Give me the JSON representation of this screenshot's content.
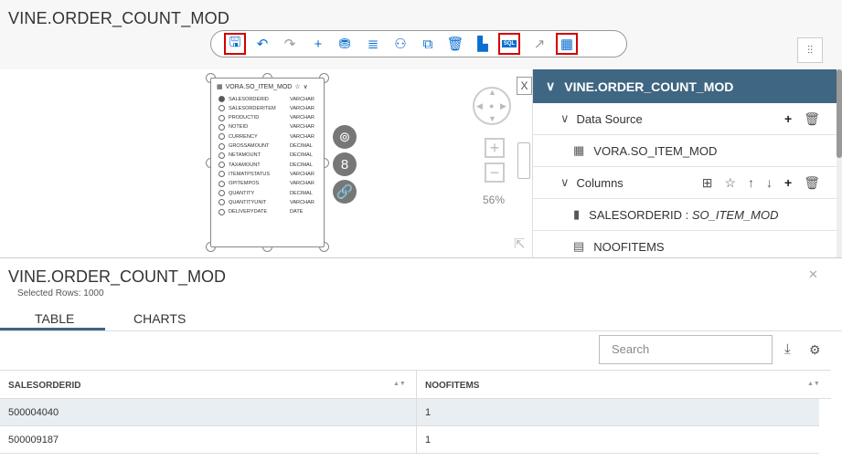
{
  "app": {
    "title": "VINE.ORDER_COUNT_MOD"
  },
  "toolbar": {
    "buttons": [
      {
        "icon": "save-icon",
        "glyph": "🖫",
        "highlighted": true
      },
      {
        "icon": "undo-icon",
        "glyph": "↶"
      },
      {
        "icon": "redo-icon",
        "glyph": "↷",
        "disabled": true
      },
      {
        "icon": "add-icon",
        "glyph": "+"
      },
      {
        "icon": "datasource-icon",
        "glyph": "⛃"
      },
      {
        "icon": "database-icon",
        "glyph": "≣"
      },
      {
        "icon": "hierarchy-icon",
        "glyph": "⚇"
      },
      {
        "icon": "preview-icon",
        "glyph": "⧉"
      },
      {
        "icon": "delete-icon",
        "glyph": "🗑"
      },
      {
        "icon": "layout-icon",
        "glyph": "▙"
      },
      {
        "icon": "sql-icon",
        "glyph": "SQL",
        "highlighted": true
      },
      {
        "icon": "external-icon",
        "glyph": "↗",
        "disabled": true
      },
      {
        "icon": "grid-icon",
        "glyph": "▦",
        "highlighted": true
      }
    ]
  },
  "canvas": {
    "table": {
      "name": "VORA.SO_ITEM_MOD",
      "columns": [
        {
          "name": "SALESORDERID",
          "type": "VARCHAR",
          "selected": true
        },
        {
          "name": "SALESORDERITEM",
          "type": "VARCHAR"
        },
        {
          "name": "PRODUCTID",
          "type": "VARCHAR"
        },
        {
          "name": "NOTEID",
          "type": "VARCHAR"
        },
        {
          "name": "CURRENCY",
          "type": "VARCHAR"
        },
        {
          "name": "GROSSAMOUNT",
          "type": "DECIMAL"
        },
        {
          "name": "NETAMOUNT",
          "type": "DECIMAL"
        },
        {
          "name": "TAXAMOUNT",
          "type": "DECIMAL"
        },
        {
          "name": "ITEMATPSTATUS",
          "type": "VARCHAR"
        },
        {
          "name": "OPITEMPOS",
          "type": "VARCHAR"
        },
        {
          "name": "QUANTITY",
          "type": "DECIMAL"
        },
        {
          "name": "QUANTITYUNIT",
          "type": "VARCHAR"
        },
        {
          "name": "DELIVERYDATE",
          "type": "DATE"
        }
      ]
    },
    "zoom": "56%",
    "close": "X"
  },
  "side": {
    "title": "VINE.ORDER_COUNT_MOD",
    "data_source_label": "Data Source",
    "data_source_item": "VORA.SO_ITEM_MOD",
    "columns_label": "Columns",
    "column1_name": "SALESORDERID : ",
    "column1_source": "SO_ITEM_MOD",
    "column2_name": "NOOFITEMS"
  },
  "result": {
    "title": "VINE.ORDER_COUNT_MOD",
    "selected_rows": "Selected Rows: 1000",
    "tab_table": "TABLE",
    "tab_charts": "CHARTS",
    "search_placeholder": "Search",
    "headers": [
      "SALESORDERID",
      "NOOFITEMS"
    ],
    "rows": [
      [
        "500004040",
        "1"
      ],
      [
        "500009187",
        "1"
      ]
    ]
  }
}
